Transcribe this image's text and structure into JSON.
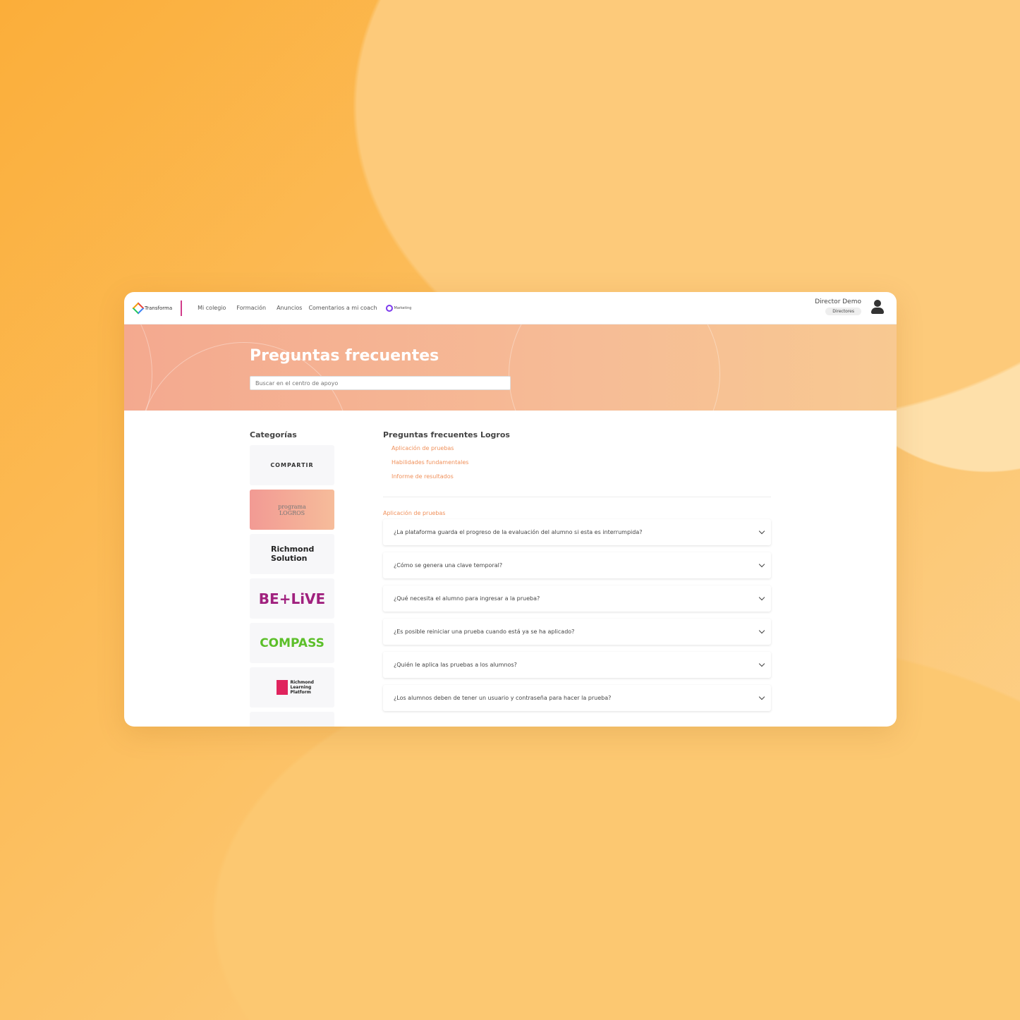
{
  "header": {
    "logo": "Transforma",
    "nav": [
      "Mi colegio",
      "Formación",
      "Anuncios",
      "Comentarios a mi coach"
    ],
    "marketing_logo": "Marketing",
    "user_name": "Director Demo",
    "user_role": "Directores"
  },
  "banner": {
    "title": "Preguntas frecuentes",
    "search_placeholder": "Buscar en el centro de apoyo"
  },
  "categories": {
    "title": "Categorías",
    "items": [
      "COMPARTIR",
      "programa LOGROS",
      "Richmond Solution",
      "BE+LiVE",
      "COMPASS",
      "Richmond Learning Platform"
    ],
    "active": "programa LOGROS"
  },
  "faq": {
    "title": "Preguntas frecuentes Logros",
    "links": [
      "Aplicación de pruebas",
      "Habilidades fundamentales",
      "Informe de resultados"
    ],
    "section": "Aplicación de pruebas",
    "questions": [
      "¿La plataforma guarda el progreso de la evaluación del alumno si esta es interrumpida?",
      "¿Cómo se genera una clave temporal?",
      "¿Qué necesita el alumno para ingresar a la prueba?",
      "¿Es posible reiniciar una prueba cuando está ya se ha aplicado?",
      "¿Quién le aplica las pruebas a los alumnos?",
      "¿Los alumnos deben de tener un usuario y contraseña para hacer la prueba?"
    ]
  },
  "colors": {
    "accent": "#f0905a",
    "background": "#fbb53f"
  }
}
